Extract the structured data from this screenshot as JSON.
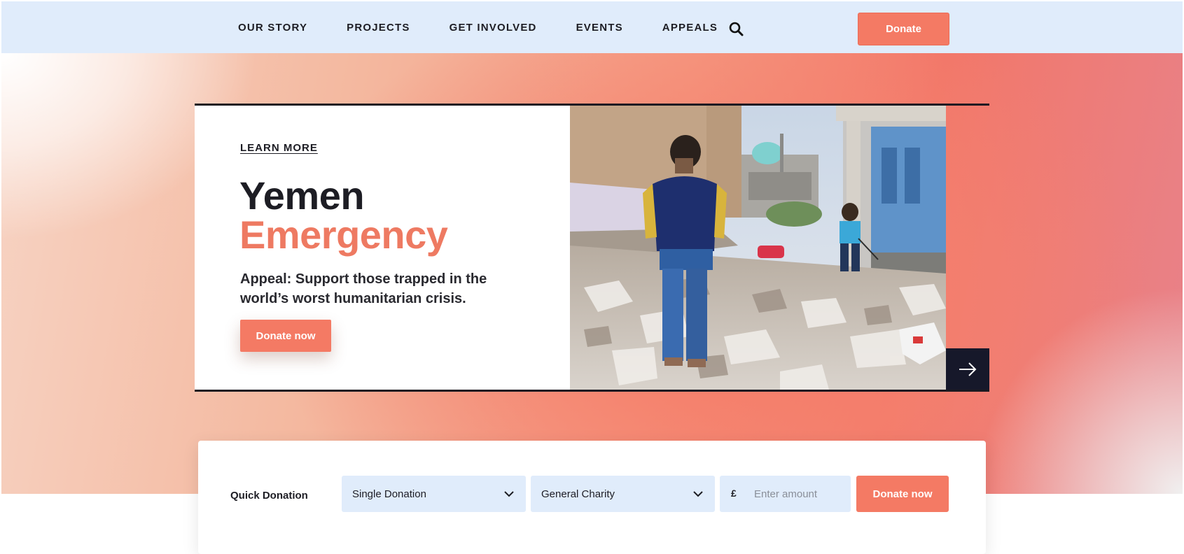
{
  "header": {
    "nav": [
      {
        "label": "OUR STORY"
      },
      {
        "label": "PROJECTS"
      },
      {
        "label": "GET INVOLVED"
      },
      {
        "label": "EVENTS"
      },
      {
        "label": "APPEALS"
      }
    ],
    "search_icon": "search-icon",
    "donate_label": "Donate"
  },
  "hero": {
    "learn_more": "LEARN MORE",
    "title_line1": "Yemen",
    "title_line2": "Emergency",
    "subtitle": "Appeal: Support those trapped in the world’s worst humanitarian crisis.",
    "donate_label": "Donate now",
    "next_icon": "arrow-right-icon"
  },
  "quick_donation": {
    "label": "Quick Donation",
    "donation_type": {
      "selected": "Single Donation"
    },
    "cause": {
      "selected": "General Charity"
    },
    "currency_symbol": "£",
    "amount": {
      "value": "",
      "placeholder": "Enter amount"
    },
    "donate_label": "Donate now"
  },
  "colors": {
    "accent": "#f47a64",
    "header_bg": "#e0ecfb",
    "dark": "#16182a"
  }
}
